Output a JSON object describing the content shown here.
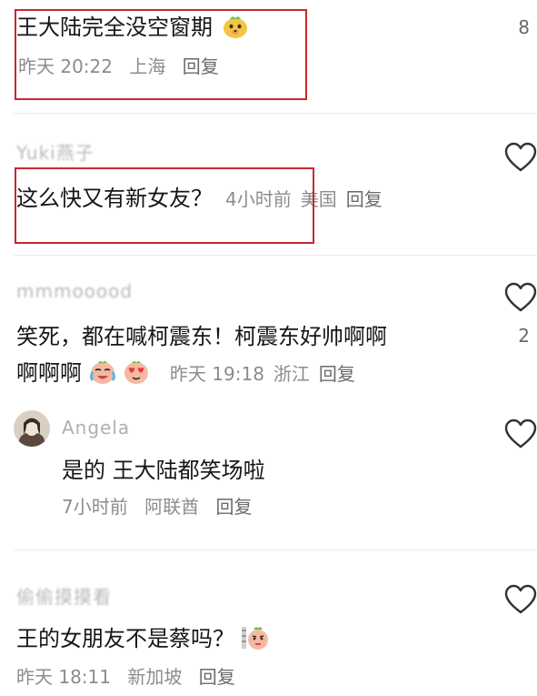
{
  "comments": [
    {
      "text": "王大陆完全没空窗期",
      "emoji": "doge-face-icon",
      "time": "昨天 20:22",
      "location": "上海",
      "reply_label": "回复",
      "like_count": "8"
    },
    {
      "username": "Yuki燕子",
      "text": "这么快又有新女友？",
      "time": "4小时前",
      "location": "美国",
      "reply_label": "回复"
    },
    {
      "username": "mmmooood",
      "text_line1": "笑死，都在喊柯震东！柯震东好帅啊啊",
      "text_line2": "啊啊啊",
      "emojis": [
        "crying-laugh-face-icon",
        "heart-eyes-face-icon"
      ],
      "time": "昨天 19:18",
      "location": "浙江",
      "reply_label": "回复",
      "like_count": "2"
    },
    {
      "username": "Angela",
      "text": "是的 王大陆都笑场啦",
      "time": "7小时前",
      "location": "阿联酋",
      "reply_label": "回复"
    },
    {
      "username": "偷偷摸摸看",
      "text": "王的女朋友不是蔡吗？",
      "emoji": "thinking-face-icon",
      "time": "昨天 18:11",
      "location": "新加坡",
      "reply_label": "回复"
    }
  ],
  "colors": {
    "highlight_box": "#c8282d",
    "primary_text": "#161616",
    "secondary_text": "#8c8c8c"
  }
}
